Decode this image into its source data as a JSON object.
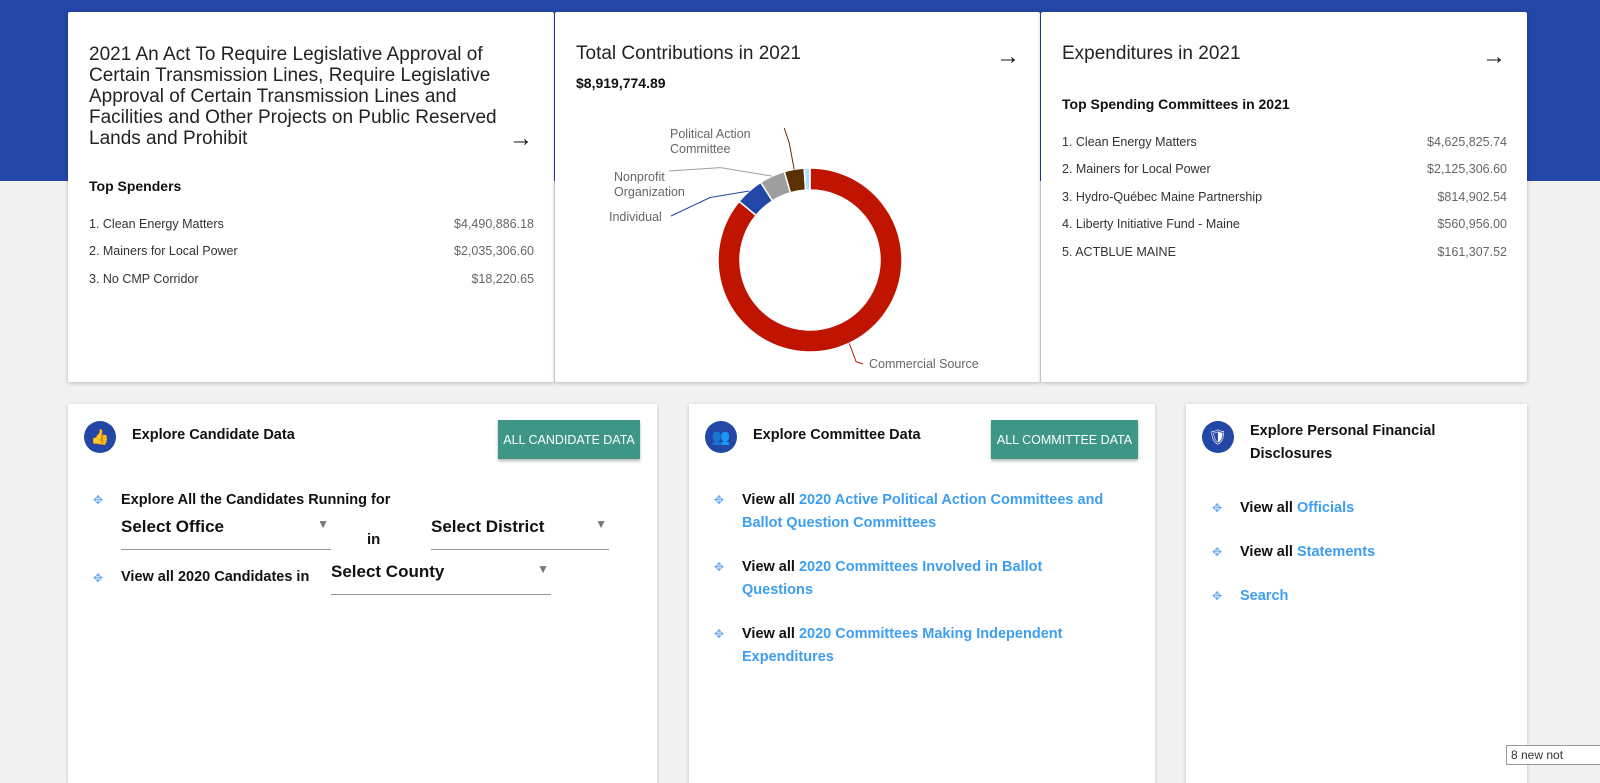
{
  "ballot": {
    "title": "2021 An Act To Require Legislative Approval of Certain Transmission Lines, Require Legislative Approval of Certain Transmission Lines and Facilities and Other Projects on Public Reserved Lands and Prohibit",
    "subtitle": "Top Spenders",
    "rows": [
      {
        "name": "1. Clean Energy Matters",
        "amount": "$4,490,886.18"
      },
      {
        "name": "2. Mainers for Local Power",
        "amount": "$2,035,306.60"
      },
      {
        "name": "3. No CMP Corridor",
        "amount": "$18,220.65"
      }
    ]
  },
  "contributions": {
    "title": "Total Contributions in 2021",
    "total": "$8,919,774.89"
  },
  "chart_data": {
    "type": "pie",
    "donut": true,
    "slices": [
      {
        "name": "Commercial Source",
        "value": 86,
        "color": "#bf1400"
      },
      {
        "name": "Individual",
        "value": 5,
        "color": "#2347a6"
      },
      {
        "name": "Nonprofit Organization",
        "value": 4.5,
        "color": "#9e9e9e"
      },
      {
        "name": "Political Action Committee",
        "value": 3.5,
        "color": "#5c3100"
      },
      {
        "name": "",
        "value": 1,
        "color": "#aee0fb"
      }
    ]
  },
  "expenditures": {
    "title": "Expenditures in 2021",
    "subtitle": "Top Spending Committees in 2021",
    "rows": [
      {
        "name": "1. Clean Energy Matters",
        "amount": "$4,625,825.74"
      },
      {
        "name": "2. Mainers for Local Power",
        "amount": "$2,125,306.60"
      },
      {
        "name": "3. Hydro-Québec Maine Partnership",
        "amount": "$814,902.54"
      },
      {
        "name": "4. Liberty Initiative Fund - Maine",
        "amount": "$560,956.00"
      },
      {
        "name": "5. ACTBLUE MAINE",
        "amount": "$161,307.52"
      }
    ]
  },
  "candidate": {
    "title": "Explore Candidate Data",
    "button": "ALL CANDIDATE DATA",
    "line1": "Explore All the Candidates Running for",
    "office": "Select Office",
    "in": "in",
    "district": "Select District",
    "line2": "View all 2020 Candidates in",
    "county": "Select County"
  },
  "committee": {
    "title": "Explore Committee Data",
    "button": "ALL COMMITTEE DATA",
    "prefix": "View all",
    "links": [
      "2020 Active Political Action Committees and Ballot Question Committees",
      "2020 Committees Involved in Ballot Questions",
      "2020 Committees Making Independent Expenditures"
    ]
  },
  "disclosures": {
    "title": "Explore Personal Financial Disclosures",
    "prefix": "View all",
    "officials": "Officials",
    "statements": "Statements",
    "search": "Search"
  },
  "toast": "8 new not"
}
